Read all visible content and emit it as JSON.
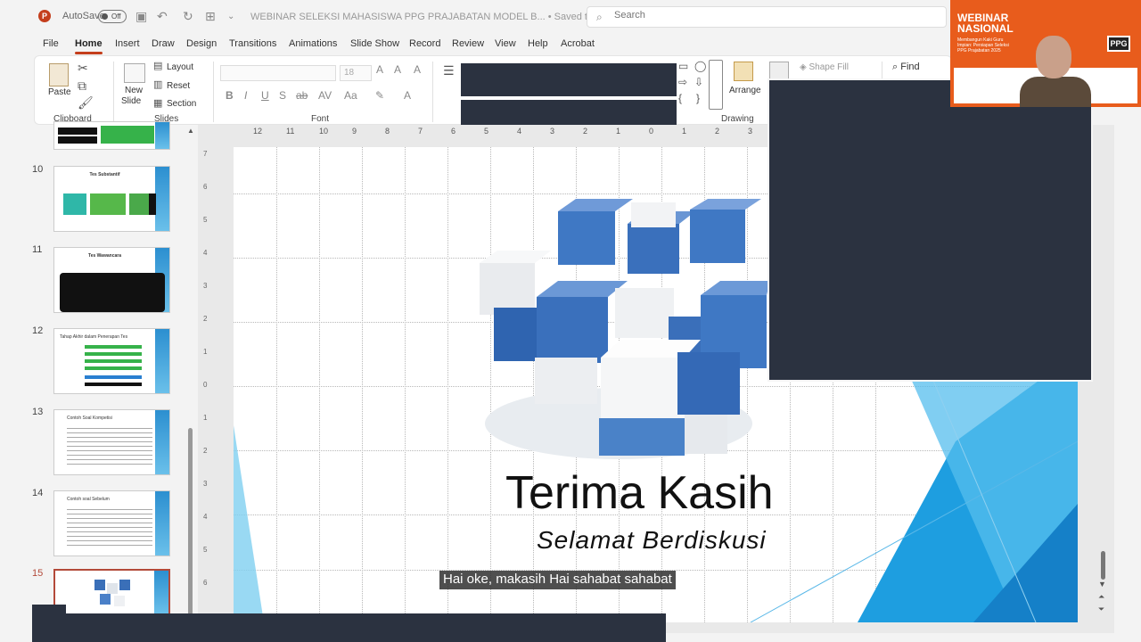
{
  "titlebar": {
    "autosave_label": "AutoSave",
    "autosave_state": "Off",
    "doc_title": "WEBINAR SELEKSI MAHASISWA PPG PRAJABATAN MODEL B...",
    "save_status": "• Saved to this PC",
    "search_placeholder": "Search"
  },
  "menu": [
    "File",
    "Home",
    "Insert",
    "Draw",
    "Design",
    "Transitions",
    "Animations",
    "Slide Show",
    "Record",
    "Review",
    "View",
    "Help",
    "Acrobat"
  ],
  "ribbon": {
    "paste": "Paste",
    "clipboard": "Clipboard",
    "new_slide_1": "New",
    "new_slide_2": "Slide",
    "layout": "Layout",
    "reset": "Reset",
    "section": "Section",
    "slides": "Slides",
    "font_size": "18",
    "font": "Font",
    "arrange": "Arrange",
    "shape_fill": "Shape Fill",
    "drawing": "Drawing",
    "find": "Find"
  },
  "thumbnails": [
    {
      "num": "10",
      "title": "Tes Substantif"
    },
    {
      "num": "11",
      "title": "Tes Wawancara"
    },
    {
      "num": "12",
      "title": "Tahap Akhir dalam Penerapan Tes"
    },
    {
      "num": "13",
      "title": "Contoh Soal Kompetisi"
    },
    {
      "num": "14",
      "title": "Contoh soal Sebelum"
    },
    {
      "num": "15",
      "title": ""
    }
  ],
  "hruler": [
    "12",
    "11",
    "10",
    "9",
    "8",
    "7",
    "6",
    "5",
    "4",
    "3",
    "2",
    "1",
    "0",
    "1",
    "2",
    "3"
  ],
  "vruler": [
    "7",
    "6",
    "5",
    "4",
    "3",
    "2",
    "1",
    "0",
    "1",
    "2",
    "3",
    "4",
    "5",
    "6"
  ],
  "slide": {
    "title": "Terima Kasih",
    "subtitle": "Selamat Berdiskusi"
  },
  "caption": "Hai oke, makasih Hai sahabat sahabat",
  "webcam": {
    "title_line1": "WEBINAR",
    "title_line2": "NASIONAL",
    "subtitle": "Membangun Kaki Guru Impian: Persiapan Seleksi PPG Prajabatan 2025",
    "badge": "PPG"
  }
}
